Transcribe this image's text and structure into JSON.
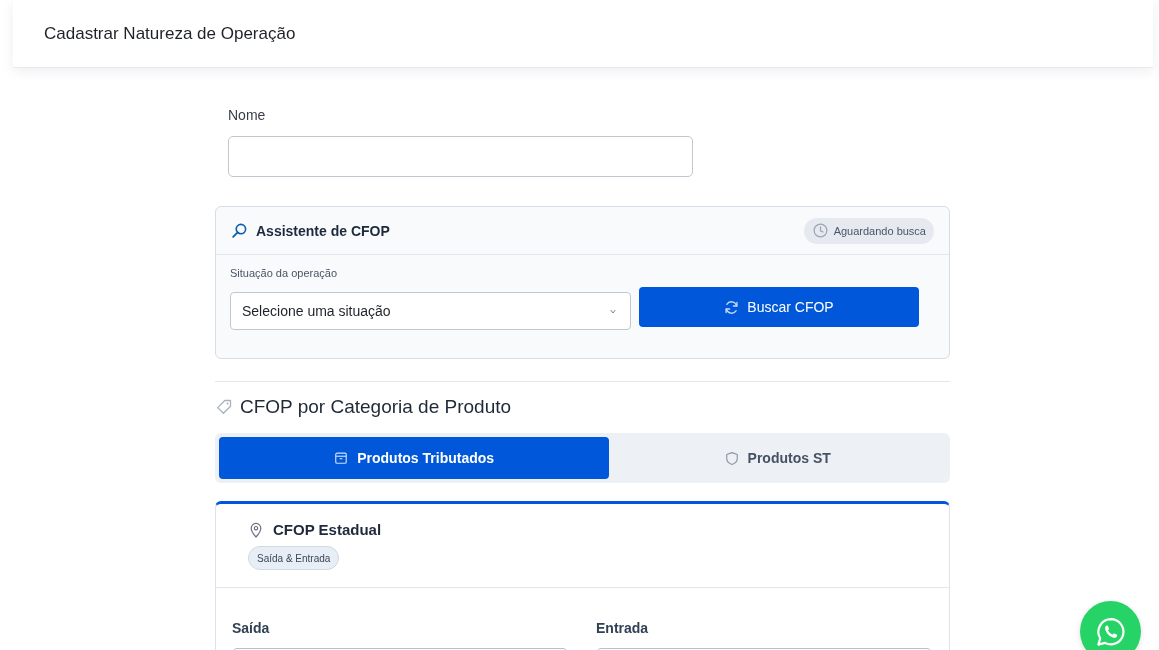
{
  "header": {
    "title": "Cadastrar Natureza de Operação"
  },
  "nome": {
    "label": "Nome"
  },
  "assistant": {
    "title": "Assistente de CFOP",
    "status": "Aguardando busca",
    "field_label": "Situação da operação",
    "select": {
      "placeholder": "Selecione uma situação"
    },
    "button": "Buscar CFOP"
  },
  "category_section": {
    "title": "CFOP por Categoria de Produto",
    "tabs": [
      {
        "label": "Produtos Tributados",
        "selected": true
      },
      {
        "label": "Produtos ST",
        "selected": false
      }
    ]
  },
  "card": {
    "title": "CFOP Estadual",
    "badge": "Saída & Entrada",
    "fields": [
      {
        "label": "Saída"
      },
      {
        "label": "Entrada"
      }
    ]
  }
}
